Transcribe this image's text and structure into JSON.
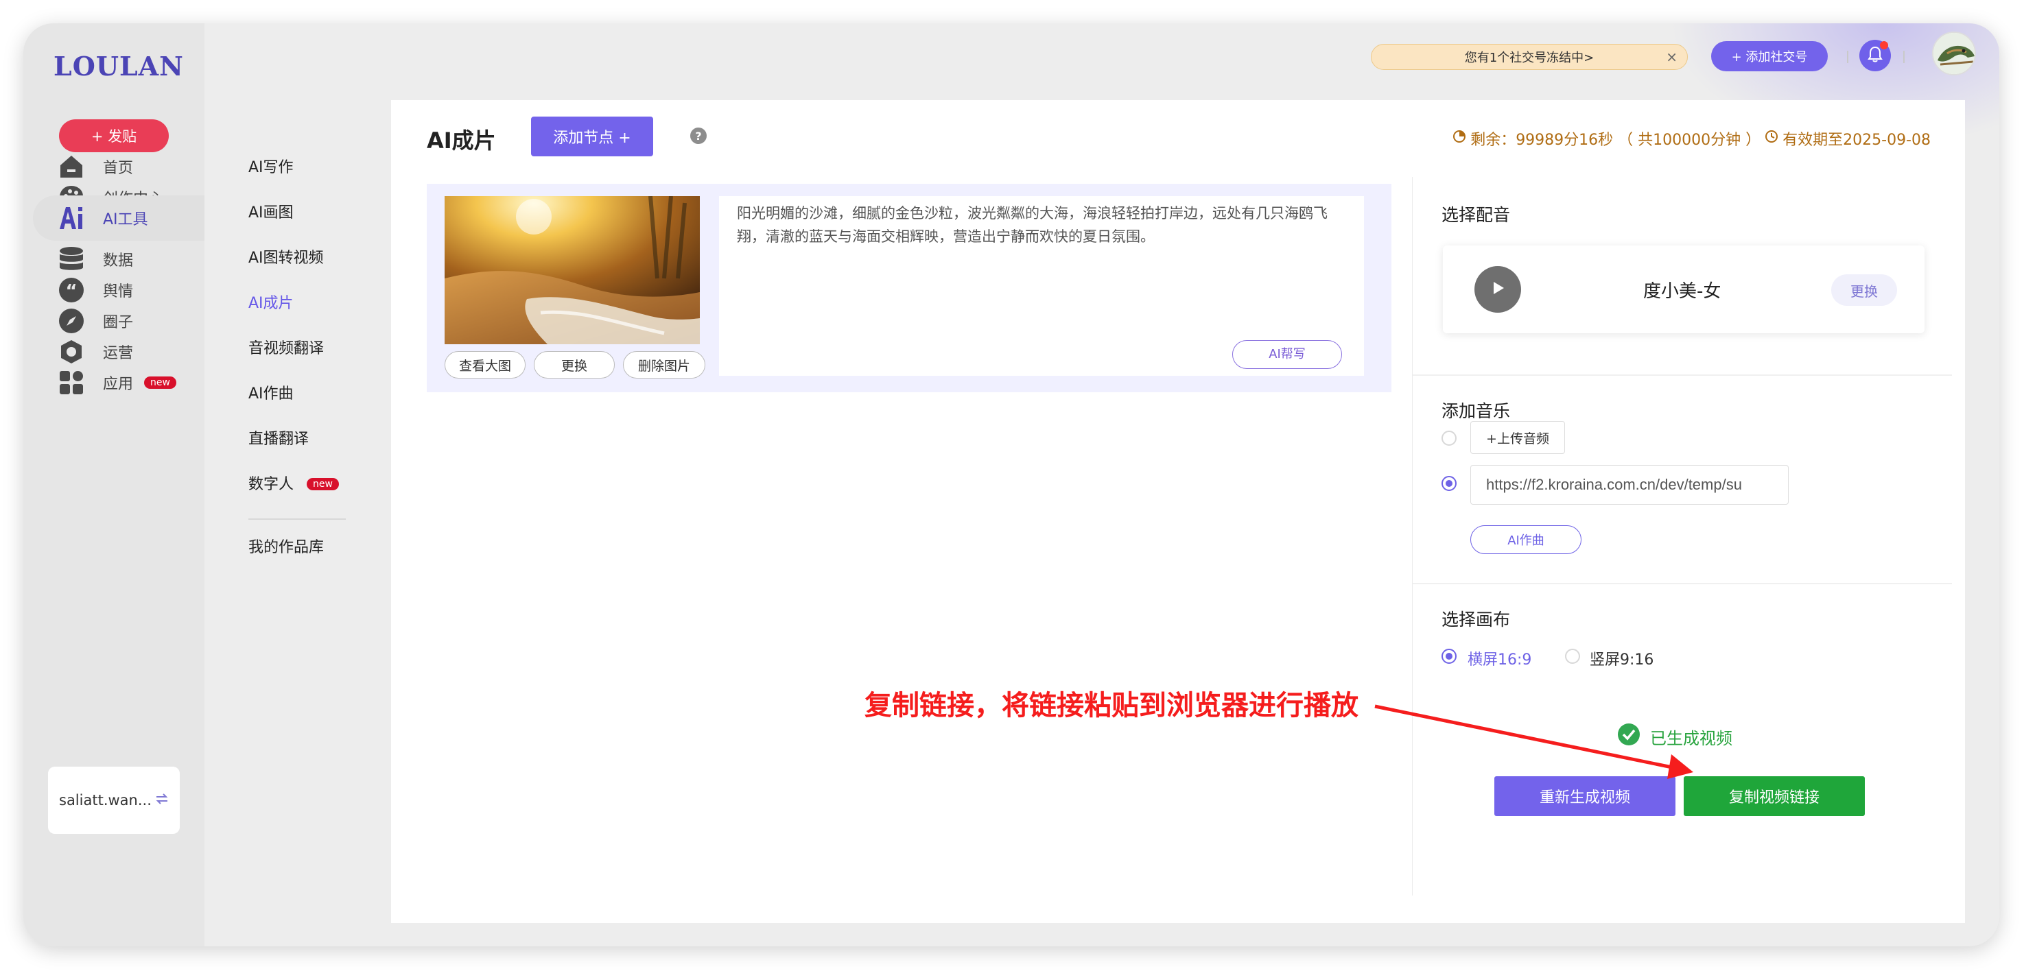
{
  "brand": {
    "logo": "LOULAN"
  },
  "actions": {
    "post_label": "+ 发贴"
  },
  "nav": {
    "items": [
      {
        "label": "首页",
        "icon": "home-icon"
      },
      {
        "label": "创作中心",
        "icon": "palette-icon"
      },
      {
        "label": "AI工具",
        "icon": "ai-icon",
        "active": true
      },
      {
        "label": "数据",
        "icon": "database-icon"
      },
      {
        "label": "舆情",
        "icon": "quote-icon"
      },
      {
        "label": "圈子",
        "icon": "compass-icon"
      },
      {
        "label": "运营",
        "icon": "operations-icon"
      },
      {
        "label": "应用",
        "icon": "apps-icon",
        "badge": "new"
      }
    ]
  },
  "account": {
    "name": "saliatt.wan...",
    "switch_icon": "swap-icon"
  },
  "header": {
    "frozen_notice": "您有1个社交号冻结中>",
    "close_icon": "close-icon",
    "add_account_label": "+ 添加社交号",
    "bell_icon": "bell-icon"
  },
  "submenu": {
    "items": [
      {
        "label": "AI写作"
      },
      {
        "label": "AI画图"
      },
      {
        "label": "AI图转视频"
      },
      {
        "label": "AI成片",
        "active": true
      },
      {
        "label": "音视频翻译"
      },
      {
        "label": "AI作曲"
      },
      {
        "label": "直播翻译"
      },
      {
        "label": "数字人",
        "badge": "new"
      },
      {
        "label": "我的作品库"
      }
    ]
  },
  "panel": {
    "title": "AI成片",
    "add_node_label": "添加节点 +",
    "help_label": "?",
    "quota_text": "剩余：99989分16秒 （ 共100000分钟 ）",
    "expiry_text": "有效期至2025-09-08"
  },
  "node": {
    "image_buttons": [
      "查看大图",
      "更换",
      "删除图片"
    ],
    "description": "阳光明媚的沙滩，细腻的金色沙粒，波光粼粼的大海，海浪轻轻拍打岸边，远处有几只海鸥飞翔，清澈的蓝天与海面交相辉映，营造出宁静而欢快的夏日氛围。",
    "ai_write_label": "AI帮写"
  },
  "voice": {
    "section_title": "选择配音",
    "name": "度小美-女",
    "change_label": "更换"
  },
  "music": {
    "section_title": "添加音乐",
    "upload_label": "+上传音频",
    "url_value": "https://f2.kroraina.com.cn/dev/temp/su",
    "ai_song_label": "AI作曲"
  },
  "canvas": {
    "section_title": "选择画布",
    "options": [
      {
        "label": "横屏16:9",
        "selected": true
      },
      {
        "label": "竖屏9:16",
        "selected": false
      }
    ]
  },
  "result": {
    "status": "已生成视频",
    "regenerate_label": "重新生成视频",
    "copy_label": "复制视频链接"
  },
  "annotation": {
    "text": "复制链接，将链接粘贴到浏览器进行播放",
    "color": "#f51d1d"
  },
  "colors": {
    "accent": "#7363eb",
    "success": "#1fa63a",
    "post": "#e93d56",
    "warning_text": "#b06d14"
  }
}
